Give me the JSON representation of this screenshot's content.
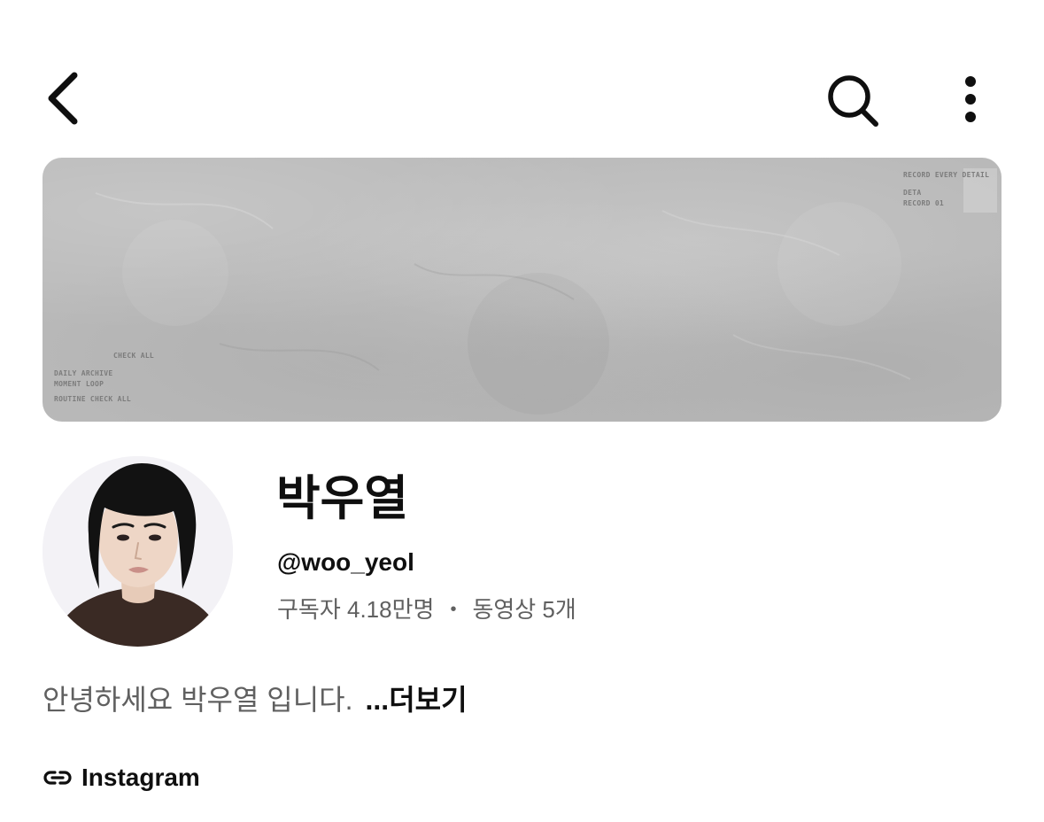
{
  "header": {
    "back_icon": "chevron-left-icon",
    "search_icon": "search-icon",
    "more_icon": "more-vertical-icon"
  },
  "banner": {
    "top_right_lines": [
      "RECORD EVERY DETAIL",
      "DETA",
      "RECORD 01"
    ],
    "bottom_left_lines": [
      "CHECK ALL",
      "DAILY ARCHIVE",
      "MOMENT LOOP",
      "ROUTINE CHECK ALL"
    ]
  },
  "channel": {
    "name": "박우열",
    "handle": "@woo_yeol",
    "subscribers": "구독자 4.18만명",
    "separator": "•",
    "videos": "동영상 5개"
  },
  "description": {
    "text": "안녕하세요 박우열 입니다.",
    "more_label": "...더보기"
  },
  "links": [
    {
      "icon": "link-icon",
      "label": "Instagram"
    }
  ],
  "colors": {
    "text_primary": "#0f0f0f",
    "text_secondary": "#606060",
    "banner_base": "#b9b9b9"
  }
}
